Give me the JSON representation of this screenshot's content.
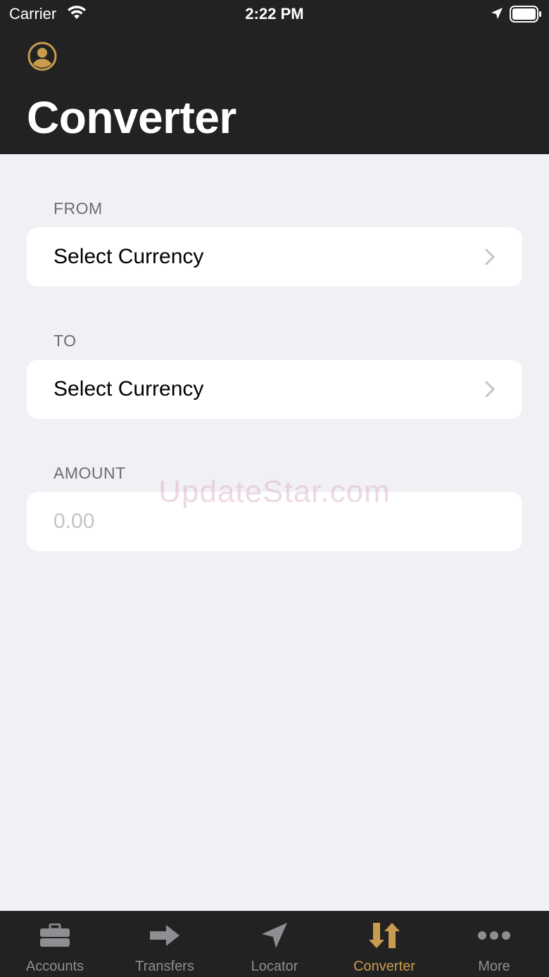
{
  "status_bar": {
    "carrier": "Carrier",
    "time": "2:22 PM"
  },
  "header": {
    "title": "Converter",
    "accent_color": "#c89b4e"
  },
  "form": {
    "from": {
      "label": "FROM",
      "value": "Select Currency"
    },
    "to": {
      "label": "TO",
      "value": "Select Currency"
    },
    "amount": {
      "label": "AMOUNT",
      "placeholder": "0.00"
    }
  },
  "watermark": "UpdateStar.com",
  "tabbar": {
    "active": "Converter",
    "items": [
      {
        "label": "Accounts",
        "icon": "briefcase-icon"
      },
      {
        "label": "Transfers",
        "icon": "arrow-right-icon"
      },
      {
        "label": "Locator",
        "icon": "location-arrow-icon"
      },
      {
        "label": "Converter",
        "icon": "swap-arrows-icon"
      },
      {
        "label": "More",
        "icon": "more-dots-icon"
      }
    ]
  }
}
